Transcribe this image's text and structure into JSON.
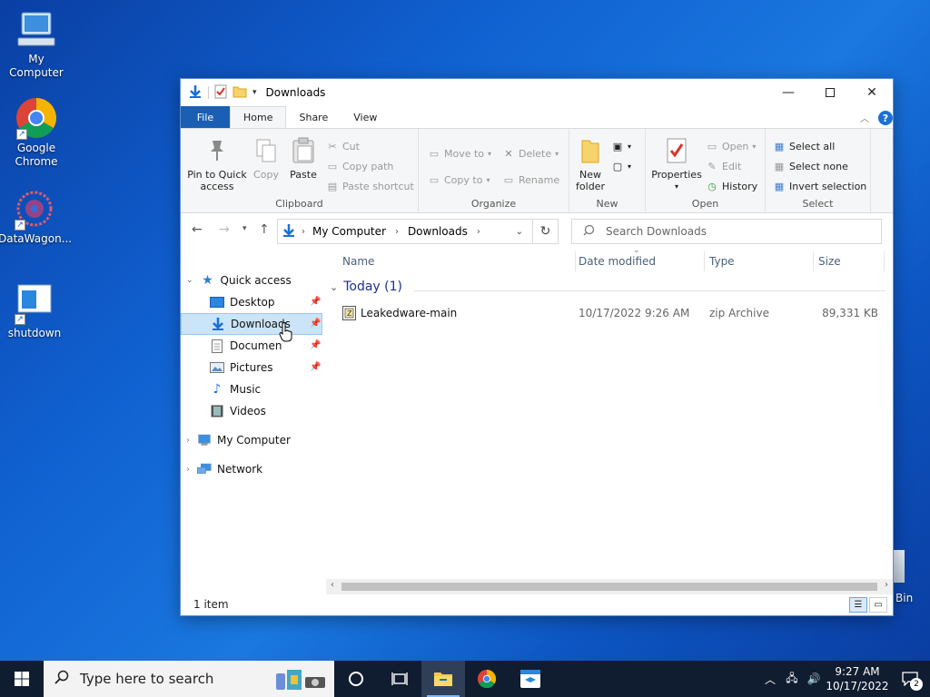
{
  "desktop": {
    "icons": [
      {
        "label": "My Computer"
      },
      {
        "label": "Google Chrome"
      },
      {
        "label": "DataWagon..."
      },
      {
        "label": "shutdown"
      }
    ],
    "recycle_bin_partial_label": "Bin"
  },
  "window": {
    "title": "Downloads",
    "tabs": {
      "file": "File",
      "home": "Home",
      "share": "Share",
      "view": "View"
    },
    "help_label": "?",
    "ribbon": {
      "clipboard": {
        "label": "Clipboard",
        "pin": "Pin to Quick access",
        "copy": "Copy",
        "paste": "Paste",
        "cut": "Cut",
        "copy_path": "Copy path",
        "paste_shortcut": "Paste shortcut"
      },
      "organize": {
        "label": "Organize",
        "move_to": "Move to",
        "copy_to": "Copy to",
        "delete": "Delete",
        "rename": "Rename"
      },
      "new": {
        "label": "New",
        "new_folder": "New folder"
      },
      "open": {
        "label": "Open",
        "properties": "Properties",
        "open": "Open",
        "edit": "Edit",
        "history": "History"
      },
      "select": {
        "label": "Select",
        "select_all": "Select all",
        "select_none": "Select none",
        "invert": "Invert selection"
      }
    },
    "address": {
      "crumbs": [
        "My Computer",
        "Downloads"
      ],
      "search_placeholder": "Search Downloads"
    },
    "nav": {
      "quick_access": "Quick access",
      "desktop": "Desktop",
      "downloads": "Downloads",
      "documents": "Documents",
      "pictures": "Pictures",
      "music": "Music",
      "videos": "Videos",
      "my_computer": "My Computer",
      "network": "Network"
    },
    "columns": {
      "name": "Name",
      "date": "Date modified",
      "type": "Type",
      "size": "Size"
    },
    "group_header": "Today (1)",
    "files": [
      {
        "name": "Leakedware-main",
        "date": "10/17/2022 9:26 AM",
        "type": "zip Archive",
        "size": "89,331 KB"
      }
    ],
    "status": "1 item"
  },
  "taskbar": {
    "search_placeholder": "Type here to search",
    "time": "9:27 AM",
    "date": "10/17/2022",
    "notification_count": "2"
  },
  "colors": {
    "accent": "#1a5fb4",
    "selection": "#cce4f7",
    "taskbar": "#101c30"
  }
}
